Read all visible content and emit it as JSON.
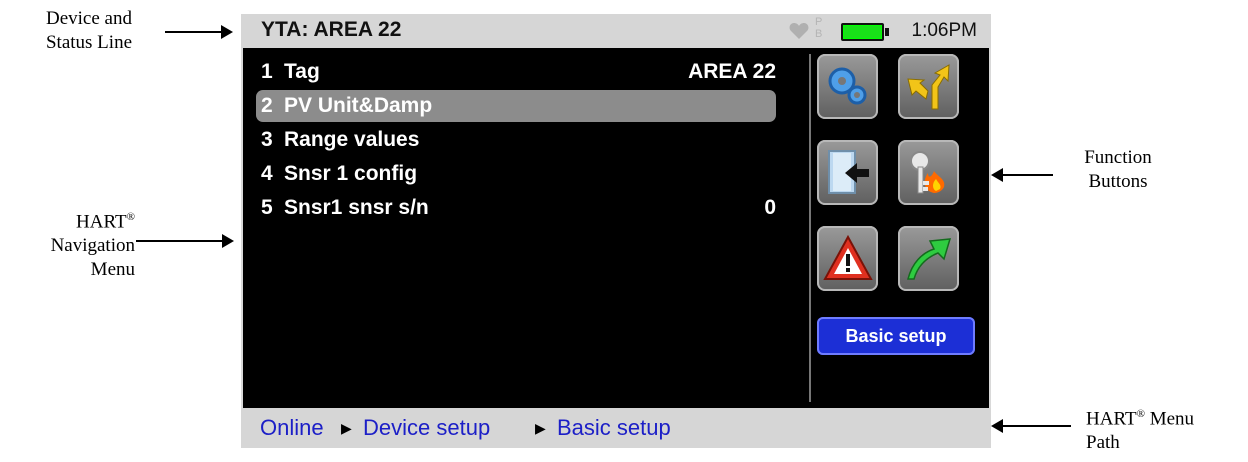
{
  "annotations": {
    "status_line": "Device and Status Line",
    "status_line_1": "Device and",
    "status_line_2": "Status Line",
    "nav_menu_1": "HART",
    "nav_menu_2": "Navigation",
    "nav_menu_3": "Menu",
    "function_1": "Function",
    "function_2": "Buttons",
    "path_1": "HART",
    "path_1b": " Menu",
    "path_2": "Path",
    "registered": "®"
  },
  "status": {
    "title": "YTA: AREA 22",
    "pb": "PB",
    "time": "1:06PM",
    "battery_level": 1.0,
    "battery_color": "#19e019"
  },
  "menu": {
    "items": [
      {
        "num": "1",
        "label": "Tag",
        "value": "AREA 22"
      },
      {
        "num": "2",
        "label": "PV Unit&Damp",
        "value": ""
      },
      {
        "num": "3",
        "label": "Range values",
        "value": ""
      },
      {
        "num": "4",
        "label": "Snsr 1 config",
        "value": ""
      },
      {
        "num": "5",
        "label": "Snsr1 snsr s/n",
        "value": "0"
      }
    ],
    "selected_index": 1
  },
  "function_buttons": {
    "icons": [
      "gears-icon",
      "fork-arrow-icon",
      "exit-door-icon",
      "key-fire-icon",
      "warning-icon",
      "green-arrow-icon"
    ],
    "basic_label": "Basic setup"
  },
  "path": {
    "segments": [
      "Online",
      "Device setup",
      "Basic setup"
    ],
    "separator": "▶"
  }
}
